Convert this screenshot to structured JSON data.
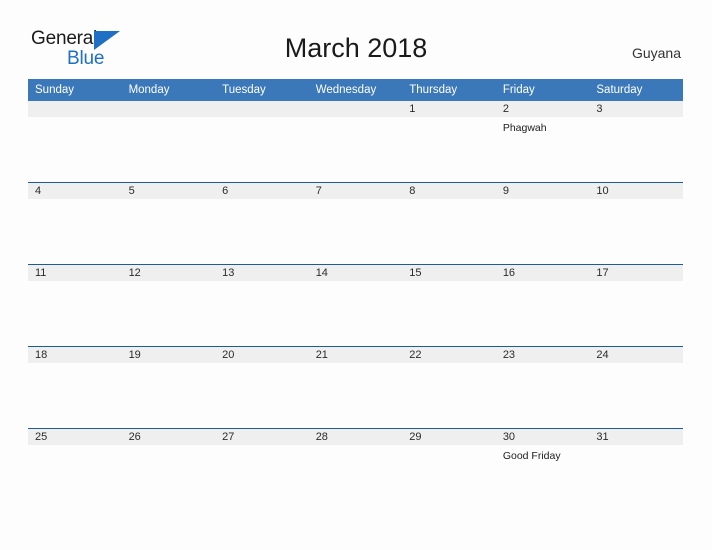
{
  "brand": {
    "name_part1": "General",
    "name_part2": "Blue",
    "accent_color": "#1f6fc4"
  },
  "header": {
    "title": "March 2018",
    "country": "Guyana"
  },
  "theme": {
    "header_blue": "#3b78b9",
    "row_divider": "#1f5b96",
    "daynum_band": "#efefef",
    "page_background": "#fdfdfd"
  },
  "calendar": {
    "weekday_headers": [
      "Sunday",
      "Monday",
      "Tuesday",
      "Wednesday",
      "Thursday",
      "Friday",
      "Saturday"
    ],
    "weeks": [
      [
        {
          "day": "",
          "holiday": ""
        },
        {
          "day": "",
          "holiday": ""
        },
        {
          "day": "",
          "holiday": ""
        },
        {
          "day": "",
          "holiday": ""
        },
        {
          "day": "1",
          "holiday": ""
        },
        {
          "day": "2",
          "holiday": "Phagwah"
        },
        {
          "day": "3",
          "holiday": ""
        }
      ],
      [
        {
          "day": "4",
          "holiday": ""
        },
        {
          "day": "5",
          "holiday": ""
        },
        {
          "day": "6",
          "holiday": ""
        },
        {
          "day": "7",
          "holiday": ""
        },
        {
          "day": "8",
          "holiday": ""
        },
        {
          "day": "9",
          "holiday": ""
        },
        {
          "day": "10",
          "holiday": ""
        }
      ],
      [
        {
          "day": "11",
          "holiday": ""
        },
        {
          "day": "12",
          "holiday": ""
        },
        {
          "day": "13",
          "holiday": ""
        },
        {
          "day": "14",
          "holiday": ""
        },
        {
          "day": "15",
          "holiday": ""
        },
        {
          "day": "16",
          "holiday": ""
        },
        {
          "day": "17",
          "holiday": ""
        }
      ],
      [
        {
          "day": "18",
          "holiday": ""
        },
        {
          "day": "19",
          "holiday": ""
        },
        {
          "day": "20",
          "holiday": ""
        },
        {
          "day": "21",
          "holiday": ""
        },
        {
          "day": "22",
          "holiday": ""
        },
        {
          "day": "23",
          "holiday": ""
        },
        {
          "day": "24",
          "holiday": ""
        }
      ],
      [
        {
          "day": "25",
          "holiday": ""
        },
        {
          "day": "26",
          "holiday": ""
        },
        {
          "day": "27",
          "holiday": ""
        },
        {
          "day": "28",
          "holiday": ""
        },
        {
          "day": "29",
          "holiday": ""
        },
        {
          "day": "30",
          "holiday": "Good Friday"
        },
        {
          "day": "31",
          "holiday": ""
        }
      ]
    ]
  }
}
